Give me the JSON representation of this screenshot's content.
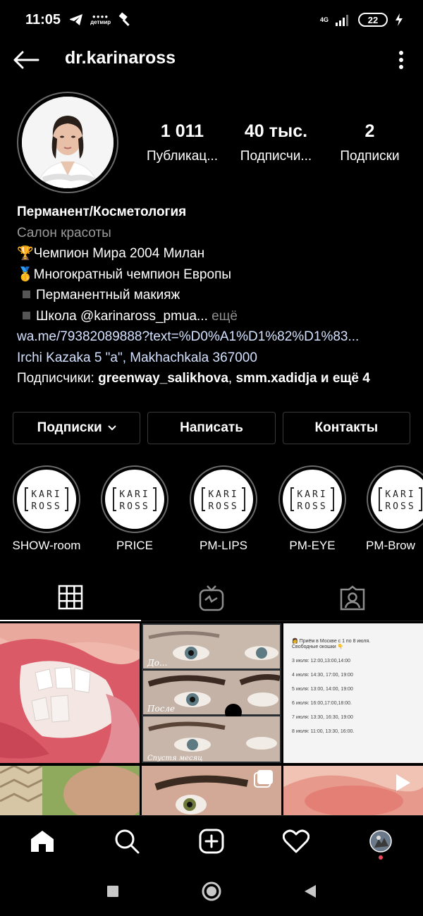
{
  "status_bar": {
    "time": "11:05",
    "network": "4G",
    "battery": "22",
    "notification_text": "детмир"
  },
  "header": {
    "username": "dr.karinaross"
  },
  "stats": [
    {
      "value": "1 011",
      "label": "Публикац..."
    },
    {
      "value": "40 тыс.",
      "label": "Подписчи..."
    },
    {
      "value": "2",
      "label": "Подписки"
    }
  ],
  "bio": {
    "name": "Перманент/Косметология",
    "category": "Салон красоты",
    "line1": "🏆Чемпион Мира 2004 Милан",
    "line2": "🥇Многократный чемпион Европы",
    "line3": "Перманентный макияж",
    "line4": "Школа @karinaross_pmua...",
    "more": "ещё",
    "link": "wa.me/79382089888?text=%D0%A1%D1%82%D1%83...",
    "address": "Irchi Kazaka 5 \"a\", Makhachkala 367000",
    "followers_prefix": "Подписчики:",
    "follower1": "greenway_salikhova",
    "separator": ",",
    "follower2": "smm.xadidja",
    "and_more": "и ещё 4"
  },
  "actions": {
    "following": "Подписки",
    "message": "Написать",
    "contacts": "Контакты"
  },
  "highlights": [
    {
      "label": "SHOW-room",
      "logo_top": "KARI",
      "logo_bottom": "ROSS"
    },
    {
      "label": "PRICE",
      "logo_top": "KARI",
      "logo_bottom": "ROSS"
    },
    {
      "label": "PM-LIPS",
      "logo_top": "KARI",
      "logo_bottom": "ROSS"
    },
    {
      "label": "PM-EYE",
      "logo_top": "KARI",
      "logo_bottom": "ROSS"
    },
    {
      "label": "PM-Brow",
      "logo_top": "KARI",
      "logo_bottom": "ROSS"
    }
  ],
  "posts": {
    "brows_before": "До...",
    "brows_after": "После",
    "brows_month": "Спустя месяц",
    "schedule_title": "👩 Приём в Москве с 1 по 8 июля.",
    "schedule_subtitle": "Свободные окошки 👇",
    "schedule_rows": [
      "3 июля: 12:00,13:00,14:00",
      "4 июля: 14:30, 17:00, 19:00",
      "5 июля: 13:00, 14:00, 19:00",
      "6 июля: 16:00,17:00,18:00.",
      "7 июля: 13:30, 16:30, 19:00",
      "8 июля: 11:00, 13:30, 16:00."
    ]
  },
  "icons": {
    "back": "arrow-left-icon",
    "more": "more-vertical-icon",
    "grid": "grid-icon",
    "igtv": "igtv-icon",
    "tagged": "tagged-icon",
    "home": "home-icon",
    "search": "search-icon",
    "add": "add-post-icon",
    "activity": "heart-icon",
    "profile": "profile-avatar-icon"
  },
  "colors": {
    "background": "#000000",
    "link": "#d3e1ff",
    "muted": "#9a9a9a",
    "notification_dot": "#ed4956"
  }
}
